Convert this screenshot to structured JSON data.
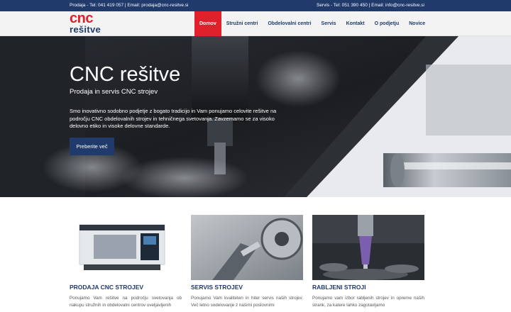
{
  "topbar": {
    "left_text": "Prodaja - Tel: 041 419 057 | Email: prodaja@cnc-resitve.si",
    "right_text": "Servis - Tel: 051 390 450 | Email: info@cnc-resitve.si"
  },
  "logo": {
    "top": "cnc",
    "bottom": "rešitve"
  },
  "nav": {
    "items": [
      "Domov",
      "Stružni centri",
      "Obdelovalni centri",
      "Servis",
      "Kontakt",
      "O podjetju",
      "Novice"
    ],
    "active": "Domov"
  },
  "hero": {
    "title": "CNC rešitve",
    "subtitle": "Prodaja in servis CNC strojev",
    "description": "Smo inovativno sodobno podjetje z bogato tradicijo in Vam ponujamo celovite rešitve na področju CNC obdelovalnih strojev in tehničnega svetovanja. Zavzemamo se za visoko delovno etiko in visoke delovne standarde.",
    "button_label": "Preberite več"
  },
  "cards": [
    {
      "title": "PRODAJA CNC STROJEV",
      "text": "Ponujamo Vam rešitve na področju svetovanja ob nakupu stružnih in obdelovalni centrov uveljavljenih"
    },
    {
      "title": "SERVIS STROJEV",
      "text": "Ponujamo Vam kvaliteten in hiter servis naših strojev. Več letno sodelovanje z našimi poslovnimi"
    },
    {
      "title": "RABLJENI STROJI",
      "text": "Ponujamo vam izbor rabljenih strojev in opreme naših strank, za katere lahko zagotavljamo"
    }
  ],
  "colors": {
    "navy": "#1f3a6b",
    "red": "#e0212b",
    "nav_bg": "#f3f3f3"
  }
}
